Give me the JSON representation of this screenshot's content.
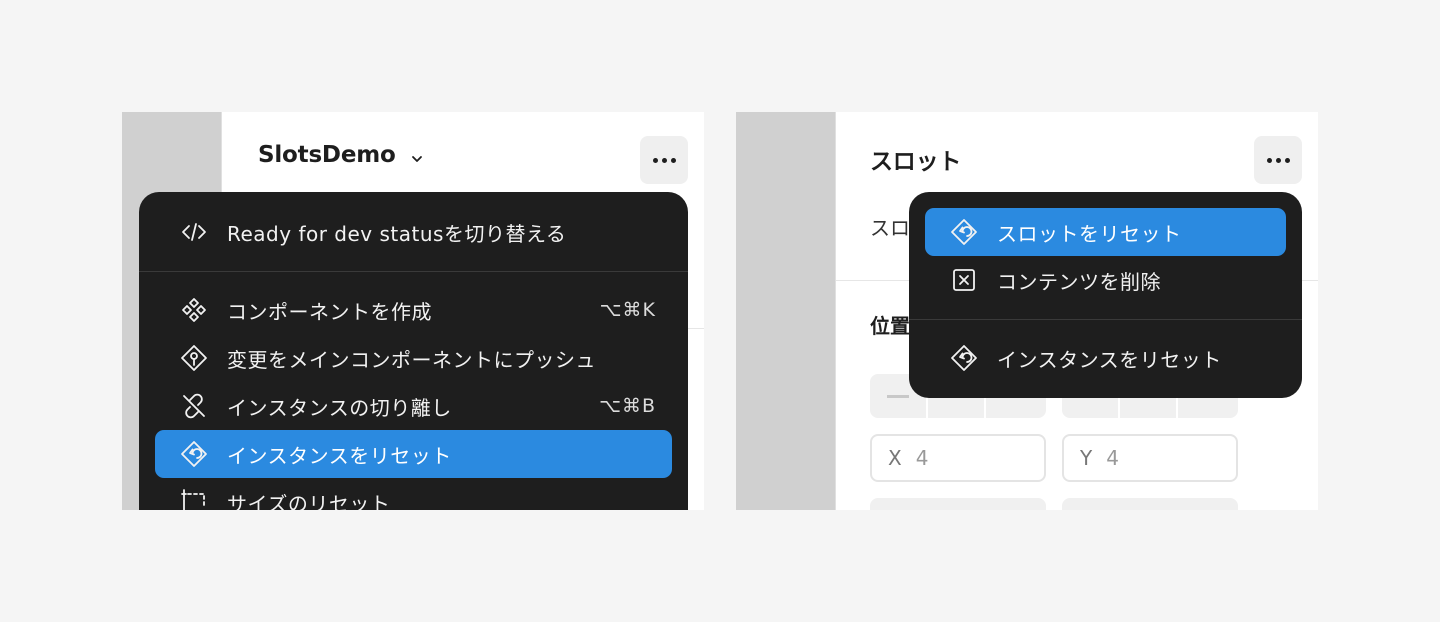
{
  "left": {
    "title": "SlotsDemo",
    "menu": {
      "items": [
        {
          "icon": "code-icon",
          "label": "Ready for dev statusを切り替える",
          "shortcut": ""
        },
        {
          "icon": "component-create-icon",
          "label": "コンポーネントを作成",
          "shortcut": "⌥⌘K"
        },
        {
          "icon": "push-to-main-icon",
          "label": "変更をメインコンポーネントにプッシュ",
          "shortcut": ""
        },
        {
          "icon": "detach-instance-icon",
          "label": "インスタンスの切り離し",
          "shortcut": "⌥⌘B"
        },
        {
          "icon": "reset-instance-icon",
          "label": "インスタンスをリセット",
          "shortcut": "",
          "active": true
        },
        {
          "icon": "reset-size-icon",
          "label": "サイズのリセット",
          "shortcut": ""
        }
      ]
    }
  },
  "right": {
    "title": "スロット",
    "section_label_partial": "スロ",
    "position_title_partial": "位置",
    "fields": [
      {
        "label": "X",
        "value": "4"
      },
      {
        "label": "Y",
        "value": "4"
      }
    ],
    "menu": {
      "items": [
        {
          "icon": "reset-slot-icon",
          "label": "スロットをリセット",
          "active": true
        },
        {
          "icon": "delete-content-icon",
          "label": "コンテンツを削除"
        },
        {
          "icon": "reset-instance-icon",
          "label": "インスタンスをリセット"
        }
      ]
    }
  },
  "colors": {
    "menu_bg": "#1e1e1e",
    "active_bg": "#2b8ae0",
    "canvas": "#d0d0d0",
    "page_bg": "#f5f5f5"
  }
}
